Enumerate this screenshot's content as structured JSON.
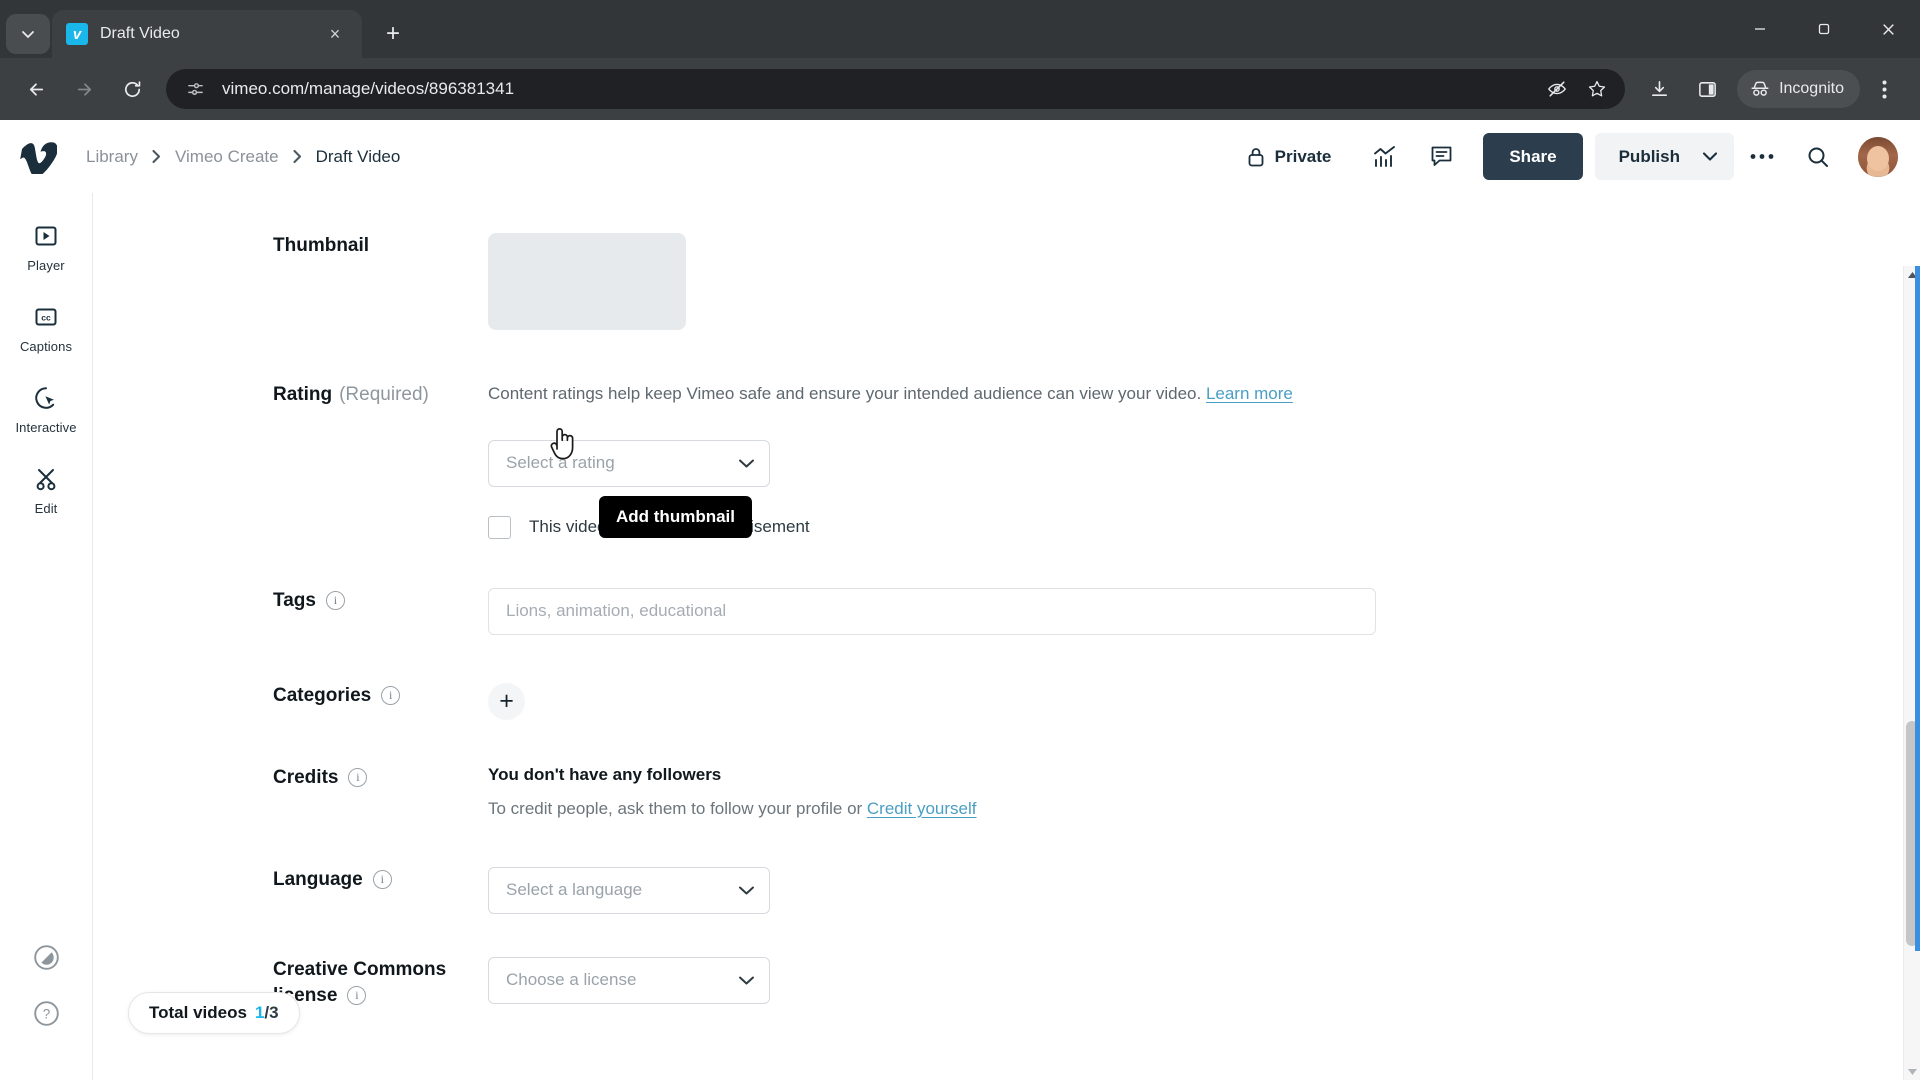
{
  "browser": {
    "tab": {
      "title": "Draft Video",
      "favicon": "vimeo-favicon",
      "close_label": "×"
    },
    "new_tab_label": "+",
    "window_controls": {
      "minimize": "—",
      "maximize": "▢",
      "close": "✕"
    },
    "omnibox": {
      "url": "vimeo.com/manage/videos/896381341",
      "site_info_icon": "site-settings-icon"
    },
    "toolbar_icons": [
      "back-icon",
      "forward-icon",
      "reload-icon",
      "tracking-protection-icon",
      "bookmark-star-icon",
      "downloads-icon",
      "side-panel-icon"
    ],
    "incognito_label": "Incognito",
    "menu_icon": "kebab-menu-icon"
  },
  "header": {
    "logo": "vimeo-logo",
    "breadcrumb": [
      {
        "label": "Library",
        "current": false
      },
      {
        "label": "Vimeo Create",
        "current": false
      },
      {
        "label": "Draft Video",
        "current": true
      }
    ],
    "privacy_label": "Private",
    "privacy_icon": "lock-icon",
    "stats_icon": "analytics-icon",
    "comments_icon": "comment-icon",
    "share_label": "Share",
    "publish_label": "Publish",
    "more_icon": "ellipsis-icon",
    "search_icon": "search-icon",
    "avatar": "user-avatar"
  },
  "rail": {
    "items": [
      {
        "label": "Player",
        "icon": "player-icon"
      },
      {
        "label": "Captions",
        "icon": "captions-cc-icon"
      },
      {
        "label": "Interactive",
        "icon": "interactive-cursor-icon"
      },
      {
        "label": "Edit",
        "icon": "scissors-edit-icon"
      }
    ],
    "bottom": [
      {
        "icon": "accessibility-contrast-icon"
      },
      {
        "icon": "help-question-icon"
      }
    ]
  },
  "form": {
    "thumbnail": {
      "label": "Thumbnail",
      "tooltip": "Add thumbnail"
    },
    "rating": {
      "label": "Rating",
      "required_suffix": "(Required)",
      "description": "Content ratings help keep Vimeo safe and ensure your intended audience can view your video.",
      "learn_more": "Learn more",
      "select_value": "Select a rating",
      "advertisement_checkbox_label": "This video contains an advertisement",
      "advertisement_checked": false
    },
    "tags": {
      "label": "Tags",
      "placeholder": "Lions, animation, educational",
      "value": ""
    },
    "categories": {
      "label": "Categories",
      "add_label": "+"
    },
    "credits": {
      "label": "Credits",
      "title": "You don't have any followers",
      "sub_prefix": "To credit people, ask them to follow your profile or ",
      "link": "Credit yourself"
    },
    "language": {
      "label": "Language",
      "select_value": "Select a language"
    },
    "creative_commons": {
      "label": "Creative Commons",
      "label_line2": "license",
      "select_value": "Choose a license"
    }
  },
  "overlay": {
    "total_videos_label": "Total videos",
    "total_videos_count": "1",
    "total_videos_total": "/3"
  },
  "colors": {
    "accent": "#1ab7ea",
    "share_button": "#2c3e4e",
    "link": "#4a9ec4",
    "scroll_highlight": "#3b8fe0"
  }
}
